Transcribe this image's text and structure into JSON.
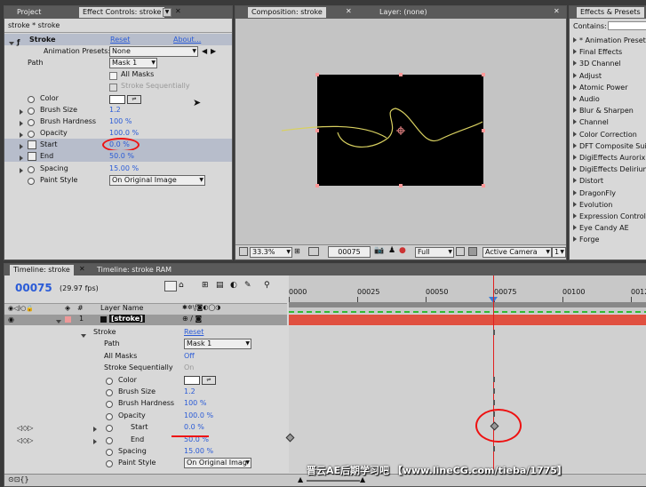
{
  "effect_controls": {
    "tabs": {
      "project": "Project",
      "effect_controls": "Effect Controls: stroke"
    },
    "breadcrumb": "stroke * stroke",
    "effect_name": "Stroke",
    "reset": "Reset",
    "about": "About...",
    "presets_label": "Animation Presets:",
    "presets_value": "None",
    "path_label": "Path",
    "path_value": "Mask 1",
    "all_masks": "All Masks",
    "stroke_seq": "Stroke Sequentially",
    "color_label": "Color",
    "brush_size_label": "Brush Size",
    "brush_size": "1.2",
    "brush_hardness_label": "Brush Hardness",
    "brush_hardness": "100 %",
    "opacity_label": "Opacity",
    "opacity": "100.0 %",
    "start_label": "Start",
    "start": "0.0 %",
    "end_label": "End",
    "end": "50.0 %",
    "spacing_label": "Spacing",
    "spacing": "15.00 %",
    "paint_style_label": "Paint Style",
    "paint_style": "On Original Image"
  },
  "composition": {
    "tab": "Composition: stroke",
    "layer_tab": "Layer: (none)",
    "zoom": "33.3%",
    "timecode": "00075",
    "resolution": "Full",
    "camera": "Active Camera",
    "views": "1"
  },
  "effects_presets": {
    "tab": "Effects & Presets",
    "contains_label": "Contains:",
    "items": [
      "* Animation Presets",
      "Final Effects",
      "3D Channel",
      "Adjust",
      "Atomic Power",
      "Audio",
      "Blur & Sharpen",
      "Channel",
      "Color Correction",
      "DFT Composite Suite",
      "DigiEffects Aurorix 2",
      "DigiEffects Delirium",
      "Distort",
      "DragonFly",
      "Evolution",
      "Expression Controls",
      "Eye Candy AE",
      "Forge"
    ]
  },
  "timeline": {
    "tab": "Timeline: stroke",
    "tab2": "Timeline: stroke RAM",
    "timecode": "00075",
    "fps": "(29.97 fps)",
    "col_num": "#",
    "col_layer": "Layer Name",
    "layer_num": "1",
    "layer_name": "[stroke]",
    "ruler": [
      "0000",
      "00025",
      "00050",
      "00075",
      "00100",
      "00125"
    ],
    "props": [
      {
        "label": "Stroke",
        "value": "Reset"
      },
      {
        "label": "Path",
        "value": "Mask 1"
      },
      {
        "label": "All Masks",
        "value": "Off"
      },
      {
        "label": "Stroke Sequentially",
        "value": "On"
      },
      {
        "label": "Color",
        "value": ""
      },
      {
        "label": "Brush Size",
        "value": "1.2"
      },
      {
        "label": "Brush Hardness",
        "value": "100 %"
      },
      {
        "label": "Opacity",
        "value": "100.0 %"
      },
      {
        "label": "Start",
        "value": "0.0 %"
      },
      {
        "label": "End",
        "value": "50.0 %"
      },
      {
        "label": "Spacing",
        "value": "15.00 %"
      },
      {
        "label": "Paint Style",
        "value": "On Original Imag"
      }
    ]
  },
  "watermark": "晋云AE后期学习吧 【www.lineCG.com/tieba/1775】"
}
